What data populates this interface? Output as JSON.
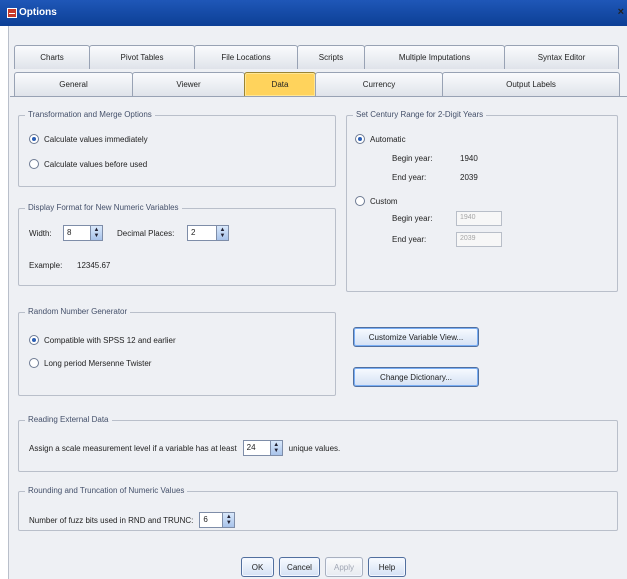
{
  "window": {
    "title": "Options"
  },
  "tabs": {
    "row1": [
      "Charts",
      "Pivot Tables",
      "File Locations",
      "Scripts",
      "Multiple Imputations",
      "Syntax Editor"
    ],
    "row2": [
      "General",
      "Viewer",
      "Data",
      "Currency",
      "Output Labels"
    ]
  },
  "transformation": {
    "title": "Transformation and Merge Options",
    "immediately": "Calculate values immediately",
    "before_used": "Calculate values before used"
  },
  "century": {
    "title": "Set Century Range for 2-Digit Years",
    "automatic": "Automatic",
    "begin_label": "Begin year:",
    "begin_value": "1940",
    "end_label": "End year:",
    "end_value": "2039",
    "custom": "Custom",
    "custom_begin_value": "1940",
    "custom_end_value": "2039"
  },
  "display_format": {
    "title": "Display Format for New Numeric Variables",
    "width_label": "Width:",
    "width_value": "8",
    "decimal_label": "Decimal Places:",
    "decimal_value": "2",
    "example_label": "Example:",
    "example_value": "12345.67"
  },
  "random": {
    "title": "Random Number Generator",
    "compatible": "Compatible with SPSS 12 and earlier",
    "mersenne": "Long period Mersenne Twister"
  },
  "buttons": {
    "customize": "Customize Variable View...",
    "change_dict": "Change Dictionary...",
    "ok": "OK",
    "cancel": "Cancel",
    "apply": "Apply",
    "help": "Help"
  },
  "external": {
    "title": "Reading External Data",
    "prefix": "Assign a scale measurement level if a variable has at least",
    "value": "24",
    "suffix": "unique values."
  },
  "rounding": {
    "title": "Rounding and Truncation of Numeric Values",
    "label": "Number of fuzz bits used in RND and TRUNC:",
    "value": "6"
  }
}
